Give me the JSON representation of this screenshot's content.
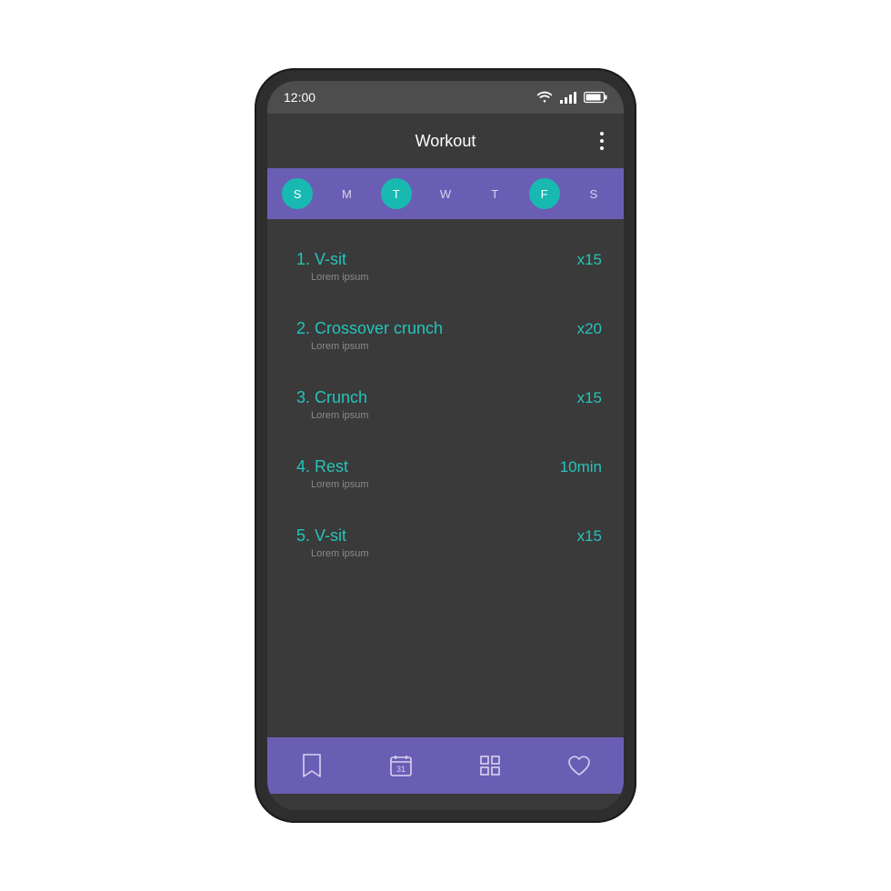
{
  "status": {
    "time": "12:00"
  },
  "header": {
    "title": "Workout"
  },
  "days": [
    {
      "label": "S",
      "active": true
    },
    {
      "label": "M",
      "active": false
    },
    {
      "label": "T",
      "active": true
    },
    {
      "label": "W",
      "active": false
    },
    {
      "label": "T",
      "active": false
    },
    {
      "label": "F",
      "active": true
    },
    {
      "label": "S",
      "active": false
    }
  ],
  "exercises": [
    {
      "title": "1. V-sit",
      "sub": "Lorem ipsum",
      "reps": "x15"
    },
    {
      "title": "2. Crossover crunch",
      "sub": "Lorem ipsum",
      "reps": "x20"
    },
    {
      "title": "3. Crunch",
      "sub": "Lorem ipsum",
      "reps": "x15"
    },
    {
      "title": "4. Rest",
      "sub": "Lorem ipsum",
      "reps": "10min"
    },
    {
      "title": "5. V-sit",
      "sub": "Lorem ipsum",
      "reps": "x15"
    }
  ],
  "nav": {
    "calendar_day": "31"
  },
  "colors": {
    "accent_purple": "#6a5eb4",
    "accent_teal": "#18b9b1",
    "text_teal": "#24c4bb"
  }
}
